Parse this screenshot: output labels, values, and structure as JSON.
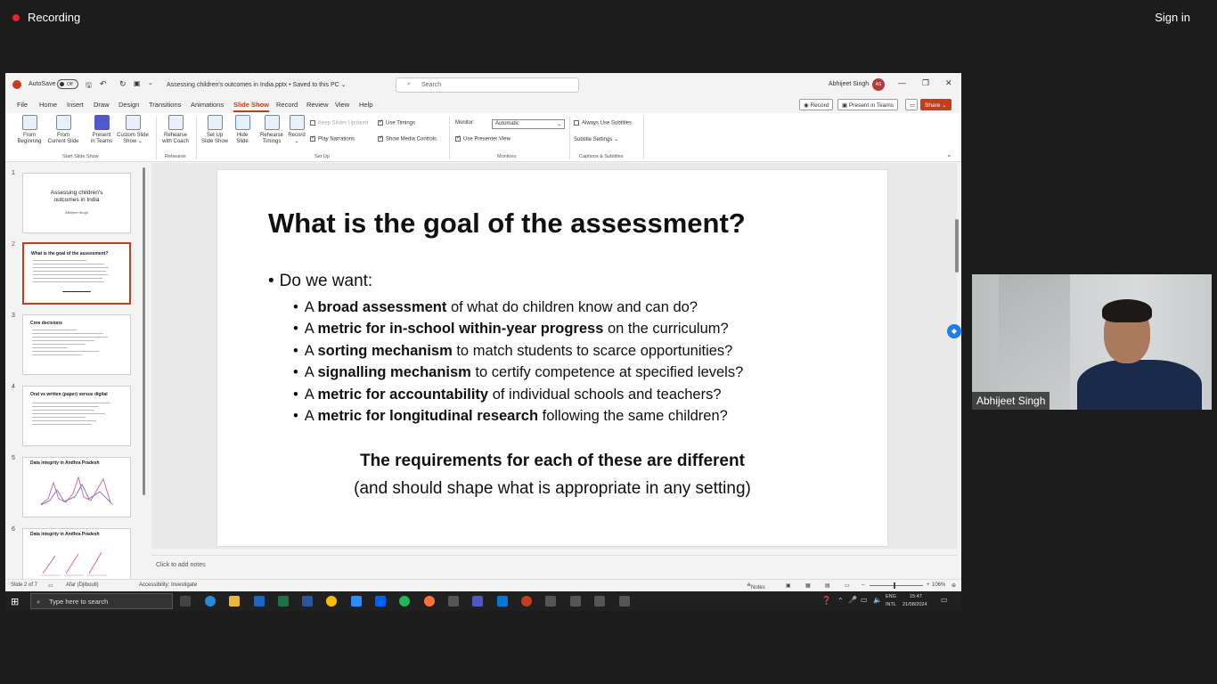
{
  "recording": {
    "label": "Recording",
    "signin": "Sign in"
  },
  "colors": {
    "accent": "#c43e1c",
    "recording_dot": "#e5252a"
  },
  "titlebar": {
    "autosave": "AutoSave",
    "autosave_state": "Off",
    "doc_title": "Assessing children's outcomes in India.pptx • Saved to this PC ⌄",
    "search_placeholder": "Search",
    "user_name": "Abhijeet Singh",
    "user_initials": "AS"
  },
  "menu": {
    "tabs": [
      "File",
      "Home",
      "Insert",
      "Draw",
      "Design",
      "Transitions",
      "Animations",
      "Slide Show",
      "Record",
      "Review",
      "View",
      "Help"
    ],
    "active_tab": "Slide Show",
    "record_btn": "Record",
    "present_teams_btn": "Present in Teams",
    "share_btn": "Share ⌄"
  },
  "ribbon": {
    "from_beginning": "From\nBeginning",
    "from_current": "From\nCurrent Slide",
    "present_teams": "Present\nin Teams",
    "custom_show": "Custom Slide\nShow ⌄",
    "rehearse_coach": "Rehearse\nwith Coach",
    "setup_show": "Set Up\nSlide Show",
    "hide_slide": "Hide\nSlide",
    "rehearse_timings": "Rehearse\nTimings",
    "record": "Record\n⌄",
    "keep_updated": "Keep Slides Updated",
    "play_narrations": "Play Narrations",
    "use_timings": "Use Timings",
    "show_media": "Show Media Controls",
    "monitor_label": "Monitor:",
    "monitor_value": "Automatic",
    "use_presenter": "Use Presenter View",
    "always_subtitles": "Always Use Subtitles",
    "subtitle_settings": "Subtitle Settings ⌄",
    "groups": [
      "Start Slide Show",
      "Rehearse",
      "Set Up",
      "Monitors",
      "Captions & Subtitles"
    ]
  },
  "thumbnails": [
    {
      "num": "1",
      "title": "Assessing children's\noutcomes in India",
      "subtitle": "Abhijeet Singh"
    },
    {
      "num": "2",
      "title": "What is the goal of the assessment?"
    },
    {
      "num": "3",
      "title": "Core decisions"
    },
    {
      "num": "4",
      "title": "Oral vs written (paper) versus digital"
    },
    {
      "num": "5",
      "title": "Data integrity in Andhra Pradesh"
    },
    {
      "num": "6",
      "title": "Data integrity in Andhra Pradesh"
    }
  ],
  "slide": {
    "title": "What is the goal of the assessment?",
    "lead": "Do we want:",
    "bullets": [
      {
        "pre": "A ",
        "bold": "broad assessment",
        "post": " of what do children know and can do?"
      },
      {
        "pre": "A ",
        "bold": "metric for in-school within-year progress",
        "post": " on the curriculum?"
      },
      {
        "pre": "A ",
        "bold": "sorting mechanism",
        "post": " to match students to scarce opportunities?"
      },
      {
        "pre": "A ",
        "bold": "signalling mechanism",
        "post": " to certify competence at specified levels?"
      },
      {
        "pre": "A ",
        "bold": "metric for accountability",
        "post": " of individual schools and teachers?"
      },
      {
        "pre": "A ",
        "bold": "metric for longitudinal research",
        "post": " following the same children?"
      }
    ],
    "requirements": "The requirements for each of these are different",
    "requirements_sub": "(and should shape what is appropriate in any setting)"
  },
  "notes_placeholder": "Click to add notes",
  "status": {
    "slide_count": "Slide 2 of 7",
    "language": "Afar (Djibouti)",
    "accessibility": "Accessibility: Investigate",
    "notes": "Notes",
    "zoom": "106%"
  },
  "taskbar": {
    "search_placeholder": "Type here to search",
    "lang": "ENG",
    "lang2": "INTL",
    "time": "15:47",
    "date": "21/08/2024"
  },
  "webcam": {
    "name": "Abhijeet Singh"
  }
}
